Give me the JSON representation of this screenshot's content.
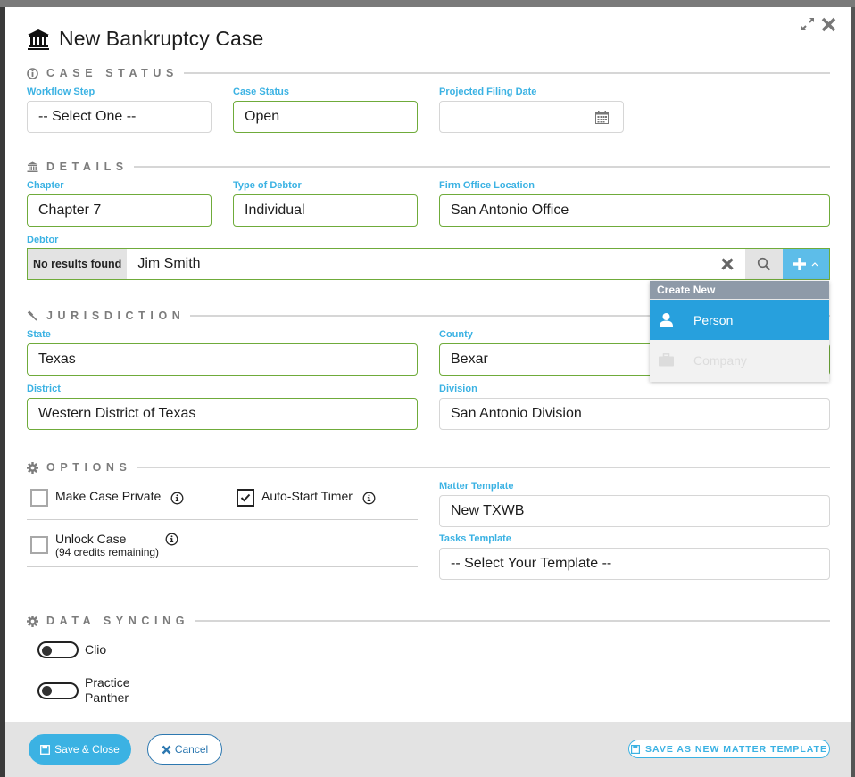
{
  "modal": {
    "title": "New Bankruptcy Case",
    "title_icon": "bank-icon",
    "actions": [
      {
        "name": "expand-icon",
        "label": "Expand"
      },
      {
        "name": "close-icon",
        "label": "Close"
      }
    ]
  },
  "sections": {
    "case_status": {
      "title": "CASE STATUS",
      "icon": "info-circle-icon"
    },
    "details": {
      "title": "DETAILS",
      "icon": "bank-icon"
    },
    "jurisdiction": {
      "title": "JURISDICTION",
      "icon": "gavel-icon"
    },
    "options": {
      "title": "OPTIONS",
      "icon": "gear-icon"
    },
    "data_syncing": {
      "title": "DATA SYNCING",
      "icon": "gear-icon"
    }
  },
  "fields": {
    "workflow_step": {
      "label": "Workflow Step",
      "value": "-- Select One --",
      "valid": false
    },
    "case_status": {
      "label": "Case Status",
      "value": "Open",
      "valid": true
    },
    "projected_filing_date": {
      "label": "Projected Filing Date",
      "value": "",
      "icon": "calendar-icon"
    },
    "chapter": {
      "label": "Chapter",
      "value": "Chapter 7",
      "valid": true
    },
    "type_of_debtor": {
      "label": "Type of Debtor",
      "value": "Individual",
      "valid": true
    },
    "firm_office_location": {
      "label": "Firm Office Location",
      "value": "San Antonio Office",
      "valid": true
    },
    "state": {
      "label": "State",
      "value": "Texas",
      "valid": true
    },
    "county": {
      "label": "County",
      "value": "Bexar",
      "valid": true
    },
    "district": {
      "label": "District",
      "value": "Western District of Texas",
      "valid": true
    },
    "division": {
      "label": "Division",
      "value": "San Antonio Division",
      "valid": false
    },
    "matter_template": {
      "label": "Matter Template",
      "value": "New TXWB"
    },
    "tasks_template": {
      "label": "Tasks Template",
      "value": "-- Select Your Template --"
    }
  },
  "debtor": {
    "label": "Debtor",
    "status": "No results found",
    "value": "Jim Smith",
    "clear_icon": "clear-icon",
    "search_icon": "search-icon",
    "add_icon": "plus-icon"
  },
  "create_new_menu": {
    "header": "Create New",
    "items": [
      {
        "label": "Person",
        "icon": "person-icon",
        "state": "active"
      },
      {
        "label": "Company",
        "icon": "briefcase-icon",
        "state": "disabled"
      }
    ]
  },
  "options": {
    "make_private": {
      "label": "Make Case Private",
      "checked": false
    },
    "auto_start_timer": {
      "label": "Auto-Start Timer",
      "checked": true
    },
    "unlock_case": {
      "label": "Unlock Case",
      "sublabel": "(94 credits remaining)",
      "checked": false
    }
  },
  "data_syncing": [
    {
      "label": "Clio",
      "on": false
    },
    {
      "label": "Practice Panther",
      "on": false
    }
  ],
  "footer": {
    "save_close_label": "Save & Close",
    "cancel_label": "Cancel",
    "save_template_label": "SAVE AS NEW MATTER TEMPLATE"
  },
  "colors": {
    "accent": "#3bb2e3",
    "valid_border": "#6fab3a",
    "menu_active": "#27a0dd",
    "menu_header": "#8e9aa8"
  }
}
